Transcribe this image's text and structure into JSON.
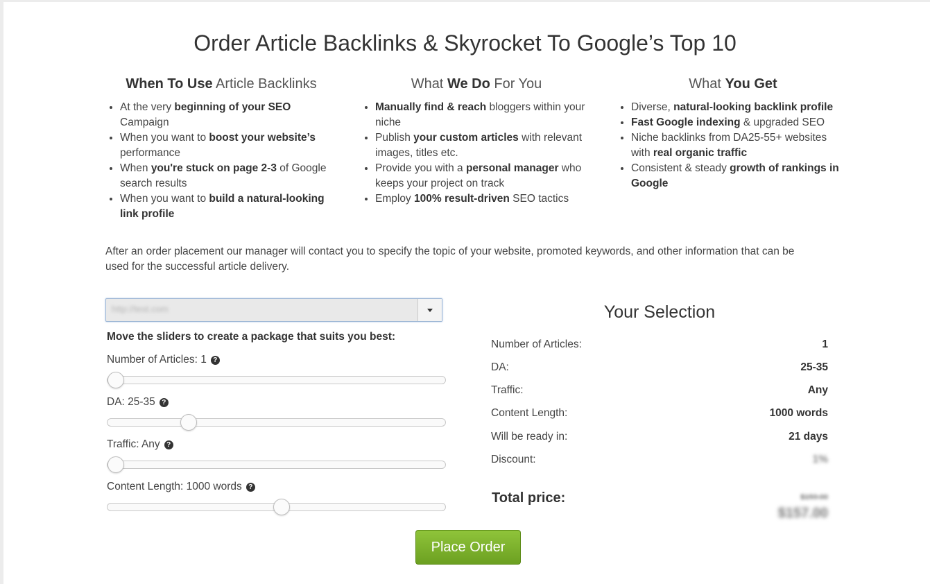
{
  "title": "Order Article Backlinks & Skyrocket To Google’s Top 10",
  "columns": [
    {
      "heading_bold": "When To Use",
      "heading_rest": " Article Backlinks",
      "items": [
        {
          "pre": "At the very ",
          "bold": "beginning of your SEO",
          "post": " Campaign"
        },
        {
          "pre": "When you want to ",
          "bold": "boost your website’s",
          "post": " performance"
        },
        {
          "pre": "When ",
          "bold": "you're stuck on page 2-3",
          "post": " of Google search results"
        },
        {
          "pre": "When you want to ",
          "bold": "build a natural-looking link profile",
          "post": ""
        }
      ]
    },
    {
      "heading_pre": "What ",
      "heading_bold": "We Do",
      "heading_rest": " For You",
      "items": [
        {
          "pre": "",
          "bold": "Manually find & reach",
          "post": " bloggers within your niche"
        },
        {
          "pre": "Publish ",
          "bold": "your custom articles",
          "post": " with relevant images, titles etc."
        },
        {
          "pre": "Provide you with a ",
          "bold": "personal manager",
          "post": " who keeps your project on track"
        },
        {
          "pre": "Employ ",
          "bold": "100% result-driven",
          "post": " SEO tactics"
        }
      ]
    },
    {
      "heading_pre": "What ",
      "heading_bold": "You Get",
      "items": [
        {
          "pre": "Diverse, ",
          "bold": "natural-looking backlink profile",
          "post": ""
        },
        {
          "pre": "",
          "bold": "Fast Google indexing",
          "post": " & upgraded SEO"
        },
        {
          "pre": "Niche backlinks from DA25-55+ websites with ",
          "bold": "real organic traffic",
          "post": ""
        },
        {
          "pre": "Consistent & steady ",
          "bold": "growth of rankings in Google",
          "post": ""
        }
      ]
    }
  ],
  "note": "After an order placement our manager will contact you to specify the topic of your website, promoted keywords, and other information that can be used for the successful article delivery.",
  "site_select": {
    "value": "http://test.com"
  },
  "sliders_heading": "Move the sliders to create a package that suits you best:",
  "sliders": [
    {
      "label": "Number of Articles: 1",
      "level": 0.0
    },
    {
      "label": "DA: 25-35",
      "level": 0.22
    },
    {
      "label": "Traffic: Any",
      "level": 0.0
    },
    {
      "label": "Content Length: 1000 words",
      "level": 0.5
    }
  ],
  "selection": {
    "title": "Your Selection",
    "rows": [
      {
        "key": "Number of Articles:",
        "value": "1"
      },
      {
        "key": "DA:",
        "value": "25-35"
      },
      {
        "key": "Traffic:",
        "value": "Any"
      },
      {
        "key": "Content Length:",
        "value": "1000 words"
      },
      {
        "key": "Will be ready in:",
        "value": "21 days"
      },
      {
        "key": "Discount:",
        "value": "1%"
      }
    ],
    "total_label": "Total price:",
    "old_price": "$159.00",
    "new_price": "$157.00"
  },
  "place_order": "Place Order",
  "colors": {
    "button": "#7bb12c"
  }
}
